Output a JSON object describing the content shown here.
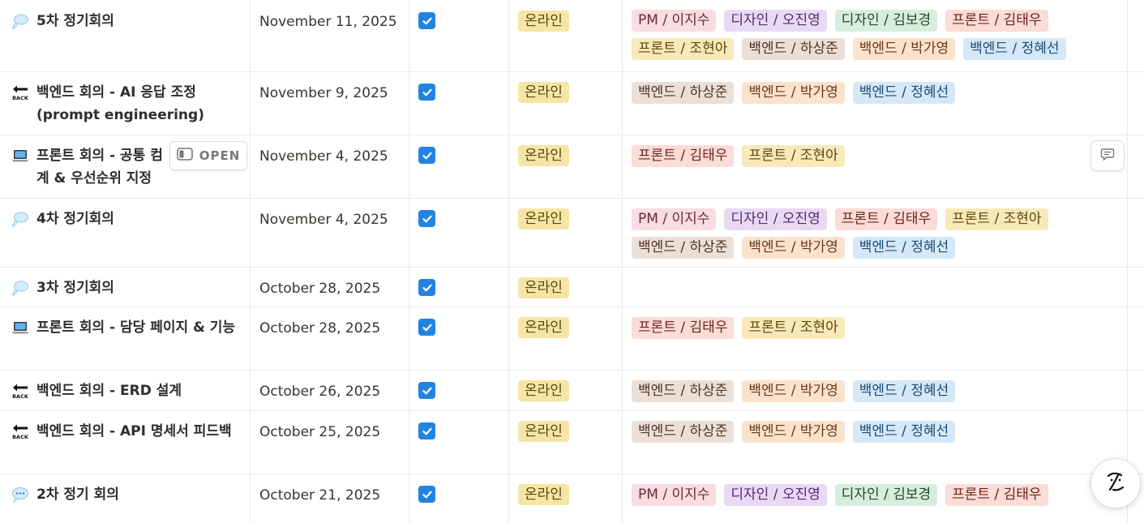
{
  "rows": [
    {
      "icon": "thought-balloon-icon",
      "title": "5차 정기회의",
      "date": "November 11, 2025",
      "checked": true,
      "type": "온라인",
      "tags": [
        {
          "label": "PM / 이지수",
          "color": "pink"
        },
        {
          "label": "디자인 / 오진영",
          "color": "purple"
        },
        {
          "label": "디자인 / 김보경",
          "color": "green"
        },
        {
          "label": "프론트 / 김태우",
          "color": "red"
        },
        {
          "label": "프론트 / 조현아",
          "color": "yellow"
        },
        {
          "label": "백엔드 / 하상준",
          "color": "brown"
        },
        {
          "label": "백엔드 / 박가영",
          "color": "orange"
        },
        {
          "label": "백엔드 / 정혜선",
          "color": "blue"
        }
      ]
    },
    {
      "icon": "back-arrow-icon",
      "title": "백엔드 회의 - AI 응답 조정 (prompt engineering)",
      "date": "November 9, 2025",
      "checked": true,
      "type": "온라인",
      "tags": [
        {
          "label": "백엔드 / 하상준",
          "color": "brown"
        },
        {
          "label": "백엔드 / 박가영",
          "color": "orange"
        },
        {
          "label": "백엔드 / 정혜선",
          "color": "blue"
        }
      ]
    },
    {
      "icon": "laptop-icon",
      "title": "프론트 회의 - 공통 컴포넌트 설계 & 우선순위 지정",
      "title_visible_line1": "프론트 회의 - 공통 컴",
      "title_visible_line2": "계 & 우선순위 지정",
      "date": "November 4, 2025",
      "checked": true,
      "type": "온라인",
      "tags": [
        {
          "label": "프론트 / 김태우",
          "color": "red"
        },
        {
          "label": "프론트 / 조현아",
          "color": "yellow"
        }
      ]
    },
    {
      "icon": "thought-balloon-icon",
      "title": "4차 정기회의",
      "date": "November 4, 2025",
      "checked": true,
      "type": "온라인",
      "tags": [
        {
          "label": "PM / 이지수",
          "color": "pink"
        },
        {
          "label": "디자인 / 오진영",
          "color": "purple"
        },
        {
          "label": "프론트 / 김태우",
          "color": "red"
        },
        {
          "label": "프론트 / 조현아",
          "color": "yellow"
        },
        {
          "label": "백엔드 / 하상준",
          "color": "brown"
        },
        {
          "label": "백엔드 / 박가영",
          "color": "orange"
        },
        {
          "label": "백엔드 / 정혜선",
          "color": "blue"
        }
      ]
    },
    {
      "icon": "thought-balloon-icon",
      "title": "3차 정기회의",
      "date": "October 28, 2025",
      "checked": true,
      "type": "온라인",
      "tags": []
    },
    {
      "icon": "laptop-icon",
      "title": "프론트 회의 - 담당 페이지 & 기능",
      "date": "October 28, 2025",
      "checked": true,
      "type": "온라인",
      "tags": [
        {
          "label": "프론트 / 김태우",
          "color": "red"
        },
        {
          "label": "프론트 / 조현아",
          "color": "yellow"
        }
      ]
    },
    {
      "icon": "back-arrow-icon",
      "title": "백엔드 회의 - ERD 설계",
      "date": "October 26, 2025",
      "checked": true,
      "type": "온라인",
      "tags": [
        {
          "label": "백엔드 / 하상준",
          "color": "brown"
        },
        {
          "label": "백엔드 / 박가영",
          "color": "orange"
        },
        {
          "label": "백엔드 / 정혜선",
          "color": "blue"
        }
      ]
    },
    {
      "icon": "back-arrow-icon",
      "title": "백엔드 회의 - API 명세서 피드백",
      "date": "October 25, 2025",
      "checked": true,
      "type": "온라인",
      "tags": [
        {
          "label": "백엔드 / 하상준",
          "color": "brown"
        },
        {
          "label": "백엔드 / 박가영",
          "color": "orange"
        },
        {
          "label": "백엔드 / 정혜선",
          "color": "blue"
        }
      ]
    },
    {
      "icon": "speech-balloon-icon",
      "title": "2차 정기 회의",
      "date": "October 21, 2025",
      "checked": true,
      "type": "온라인",
      "tags": [
        {
          "label": "PM / 이지수",
          "color": "pink"
        },
        {
          "label": "디자인 / 오진영",
          "color": "purple"
        },
        {
          "label": "디자인 / 김보경",
          "color": "green"
        },
        {
          "label": "프론트 / 김태우",
          "color": "red"
        }
      ]
    }
  ],
  "open_button": {
    "label": "OPEN"
  },
  "back_icon_text": "BACK",
  "colors": {
    "checkbox": "#2383e2",
    "type_tag": "#f7e5a5",
    "border": "#e9e9e7"
  }
}
